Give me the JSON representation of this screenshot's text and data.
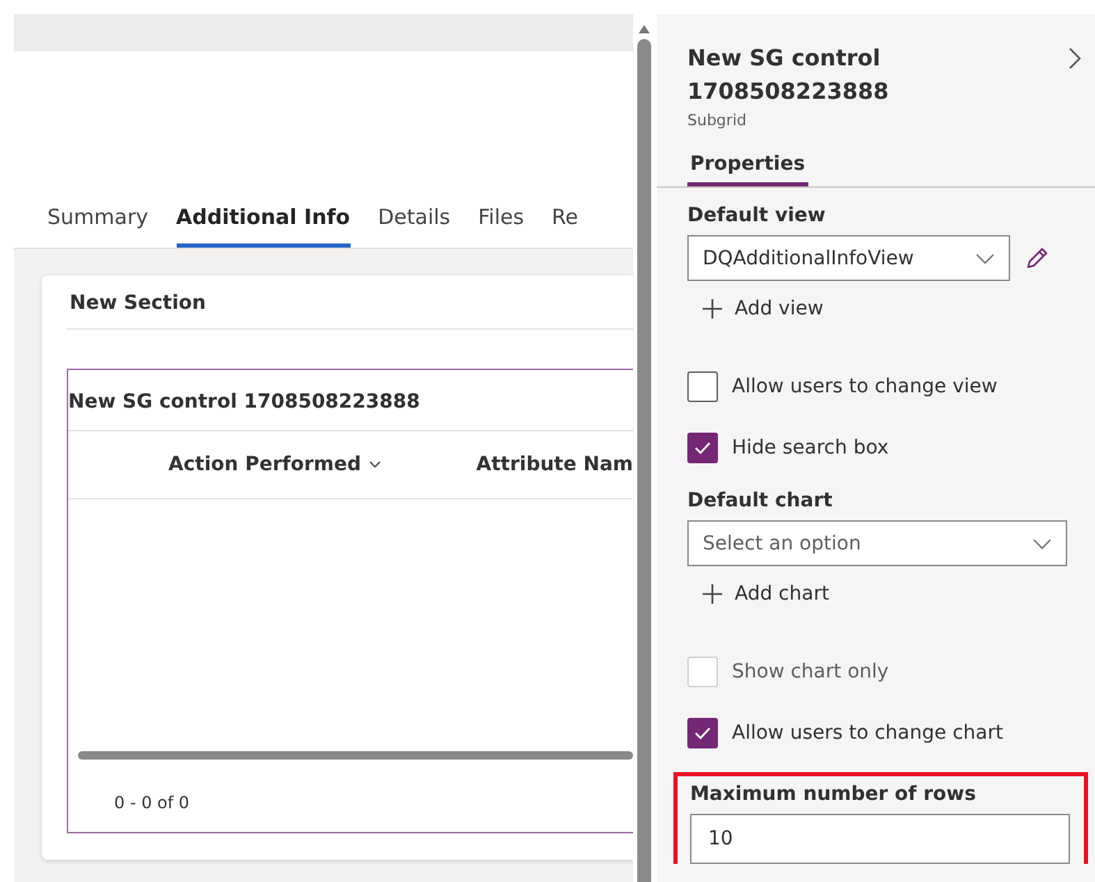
{
  "tabs": [
    {
      "label": "Summary",
      "selected": false
    },
    {
      "label": "Additional Info",
      "selected": true
    },
    {
      "label": "Details",
      "selected": false
    },
    {
      "label": "Files",
      "selected": false
    },
    {
      "label": "Re",
      "selected": false
    }
  ],
  "section": {
    "title": "New Section",
    "subgrid": {
      "title": "New SG control 1708508223888",
      "columns": [
        {
          "label": "Action Performed",
          "sortable": true
        },
        {
          "label": "Attribute Nam",
          "sortable": false
        }
      ],
      "paging": "0 - 0 of 0"
    }
  },
  "panel": {
    "title": "New SG control 1708508223888",
    "subtitle": "Subgrid",
    "tabs": [
      {
        "label": "Properties",
        "selected": true
      }
    ],
    "items": [
      {
        "kind": "label",
        "text": "Default view"
      },
      {
        "kind": "dropdown",
        "value": "DQAdditionalInfoView",
        "editable": true
      },
      {
        "kind": "add",
        "text": "Add view"
      },
      {
        "kind": "checkbox",
        "text": "Allow users to change view",
        "checked": false,
        "disabled": false
      },
      {
        "kind": "checkbox",
        "text": "Hide search box",
        "checked": true,
        "disabled": false
      },
      {
        "kind": "label",
        "text": "Default chart"
      },
      {
        "kind": "dropdown",
        "placeholder": "Select an option",
        "editable": false
      },
      {
        "kind": "add",
        "text": "Add chart"
      },
      {
        "kind": "checkbox",
        "text": "Show chart only",
        "checked": false,
        "disabled": true
      },
      {
        "kind": "checkbox",
        "text": "Allow users to change chart",
        "checked": true,
        "disabled": false
      },
      {
        "kind": "number",
        "label": "Maximum number of rows",
        "value": "10",
        "highlighted": true
      }
    ]
  }
}
